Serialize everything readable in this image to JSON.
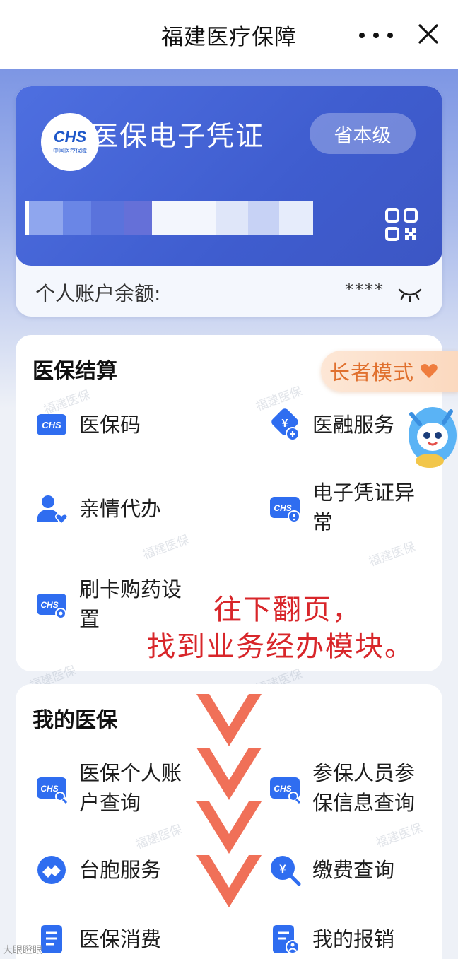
{
  "header": {
    "title": "福建医疗保障",
    "more_icon": "more-horizontal-icon",
    "close_icon": "close-icon"
  },
  "card": {
    "logo_text": "CHS",
    "logo_subtext": "中国医疗保障",
    "title": "医保电子凭证",
    "level_label": "省本级",
    "qr_icon": "qr-code-icon"
  },
  "balance": {
    "label": "个人账户余额:",
    "masked_value": "****",
    "eye_icon": "eye-closed-icon"
  },
  "settlement": {
    "title": "医保结算",
    "items": [
      {
        "label": "医保码",
        "icon": "chs-code-icon"
      },
      {
        "label": "医融服务",
        "icon": "finance-service-icon"
      },
      {
        "label": "亲情代办",
        "icon": "family-proxy-icon"
      },
      {
        "label": "电子凭证异常",
        "icon": "voucher-alert-icon"
      },
      {
        "label": "刷卡购药设置",
        "icon": "card-purchase-settings-icon"
      }
    ]
  },
  "elder_mode": {
    "label": "长者模式",
    "icon": "heart-icon"
  },
  "annotation": {
    "line1": "往下翻页，",
    "line2": "找到业务经办模块。"
  },
  "my_insurance": {
    "title": "我的医保",
    "items": [
      {
        "label": "医保个人账户查询",
        "icon": "account-search-icon"
      },
      {
        "label": "参保人员参保信息查询",
        "icon": "insured-info-search-icon"
      },
      {
        "label": "台胞服务",
        "icon": "compatriot-service-icon"
      },
      {
        "label": "缴费查询",
        "icon": "payment-search-icon"
      },
      {
        "label": "医保消费",
        "icon": "consumption-icon"
      },
      {
        "label": "我的报销",
        "icon": "reimbursement-icon"
      }
    ]
  },
  "watermark_text": "福建医保",
  "footer_mark": "大眼瞪眼",
  "colors": {
    "primary_blue": "#2f6df0",
    "card_blue": "#4e6fe0",
    "annotation_red": "#d8262a",
    "elder_orange": "#e0702e",
    "chevron_orange": "#f07058"
  }
}
